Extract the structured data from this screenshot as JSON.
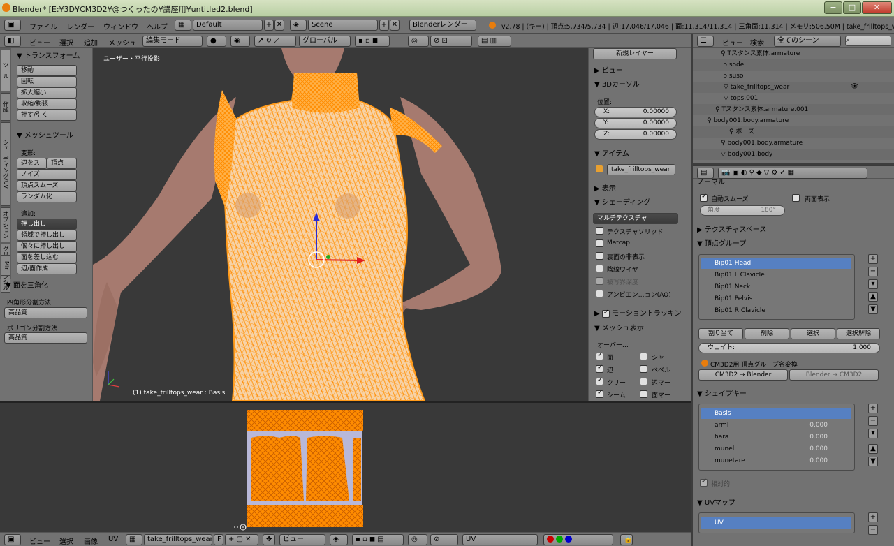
{
  "titlebar": {
    "title": "Blender* [E:¥3D¥CM3D2¥@つくったの¥講座用¥untitled2.blend]",
    "min": "−",
    "max": "□",
    "close": "✕"
  },
  "info": {
    "menus": [
      "ファイル",
      "レンダー",
      "ウィンドウ",
      "ヘルプ"
    ],
    "layout": "Default",
    "scene": "Scene",
    "engine": "Blenderレンダー",
    "stats": "v2.78 | (キー) | 頂点:5,734/5,734 | 辺:17,046/17,046 | 面:11,314/11,314 | 三角面:11,314 | メモリ:506.50M | take_frilltops_wear"
  },
  "view3d_header": {
    "menus": [
      "ビュー",
      "選択",
      "追加",
      "メッシュ"
    ],
    "mode": "編集モード",
    "orientation": "グローバル"
  },
  "tools": {
    "tabs": [
      "ツール",
      "作成",
      "シェーディング/UV",
      "オプション",
      "グリースペンシル",
      "Mir"
    ],
    "transform_title": "▼ トランスフォーム",
    "transform": [
      "移動",
      "回転",
      "拡大縮小",
      "収縮/膨張",
      "押す/引く"
    ],
    "mesh_tools_title": "▼ メッシュツール",
    "deform_label": "変形:",
    "deform_pair": [
      "辺をス",
      "頂点"
    ],
    "deform": [
      "ノイズ",
      "頂点スムーズ",
      "ランダム化"
    ],
    "add_label": "追加:",
    "add": [
      "押し出し",
      "領域で押し出し",
      "個々に押し出し",
      "面を差し込む",
      "辺/面作成"
    ],
    "tri_title": "▼ 面を三角化",
    "quad_label": "四角形分割方法",
    "quad_value": "高品質",
    "poly_label": "ポリゴン分割方法",
    "poly_value": "高品質"
  },
  "viewport": {
    "label_top": "ユーザー・平行投影",
    "label_bottom": "(1) take_frilltops_wear : Basis"
  },
  "npanel": {
    "new_layer": "新規レイヤー",
    "view": "▶ ビュー",
    "cursor_title": "▼ 3Dカーソル",
    "location": "位置:",
    "x_label": "X:",
    "x": "0.00000",
    "y_label": "Y:",
    "y": "0.00000",
    "z_label": "Z:",
    "z": "0.00000",
    "item_title": "▼ アイテム",
    "item_name": "take_frilltops_wear",
    "display": "▶ 表示",
    "shading_title": "▼ シェーディング",
    "shading_mode": "マルチテクスチャ",
    "shading_opts": [
      "テクスチャソリッド",
      "Matcap",
      "裏面の非表示",
      "陰線ワイヤ",
      "被写界深度",
      "アンビエン…ョン(AO)"
    ],
    "motion": "モーショントラッキン",
    "meshdisp_title": "▼ メッシュ表示",
    "overlay": "オーバー…",
    "overlay_left": [
      "面",
      "辺",
      "クリー",
      "シーム"
    ],
    "overlay_right": [
      "シャー",
      "ベベル",
      "辺マー",
      "面マー"
    ]
  },
  "outliner": {
    "menus": [
      "ビュー",
      "検索"
    ],
    "filter": "全てのシーン",
    "rows": [
      "Tスタンス素体.armature",
      "sode",
      "suso",
      "take_frilltops_wear",
      "tops.001",
      "Tスタンス素体.armature.001",
      "body001.body.armature",
      "ポーズ",
      "body001.body.armature",
      "body001.body"
    ]
  },
  "properties": {
    "normal_title": "ノーマル",
    "autosmooth": "自動スムーズ",
    "double_sided": "両面表示",
    "angle": "角度:",
    "angle_value": "180°",
    "texspace": "▶ テクスチャスペース",
    "vgroups_title": "▼ 頂点グループ",
    "vgroups": [
      "Bip01 Head",
      "Bip01 L Clavicle",
      "Bip01 Neck",
      "Bip01 Pelvis",
      "Bip01 R Clavicle"
    ],
    "assign": "割り当て",
    "remove": "削除",
    "select": "選択",
    "deselect": "選択解除",
    "weight_label": "ウェイト:",
    "weight_value": "1.000",
    "rename_title": "CM3D2用 頂点グループ名変換",
    "to_blender": "CM3D2 → Blender",
    "to_cm3d2": "Blender → CM3D2",
    "shapekeys_title": "▼ シェイプキー",
    "shapekeys": [
      {
        "name": "Basis",
        "value": ""
      },
      {
        "name": "arml",
        "value": "0.000"
      },
      {
        "name": "hara",
        "value": "0.000"
      },
      {
        "name": "munel",
        "value": "0.000"
      },
      {
        "name": "munetare",
        "value": "0.000"
      }
    ],
    "relative": "相対的",
    "uvmap_title": "▼ UVマップ",
    "uvmap": "UV"
  },
  "uv_header": {
    "menus": [
      "ビュー",
      "選択",
      "画像",
      "UV"
    ],
    "image": "take_frilltops_wear...",
    "f_label": "F",
    "view_mode": "ビュー",
    "uvmap": "UV"
  },
  "colors": {
    "mesh": "#ff9a1a",
    "skin": "#a67a6f",
    "select": "#5680c2",
    "bg": "#393939"
  }
}
